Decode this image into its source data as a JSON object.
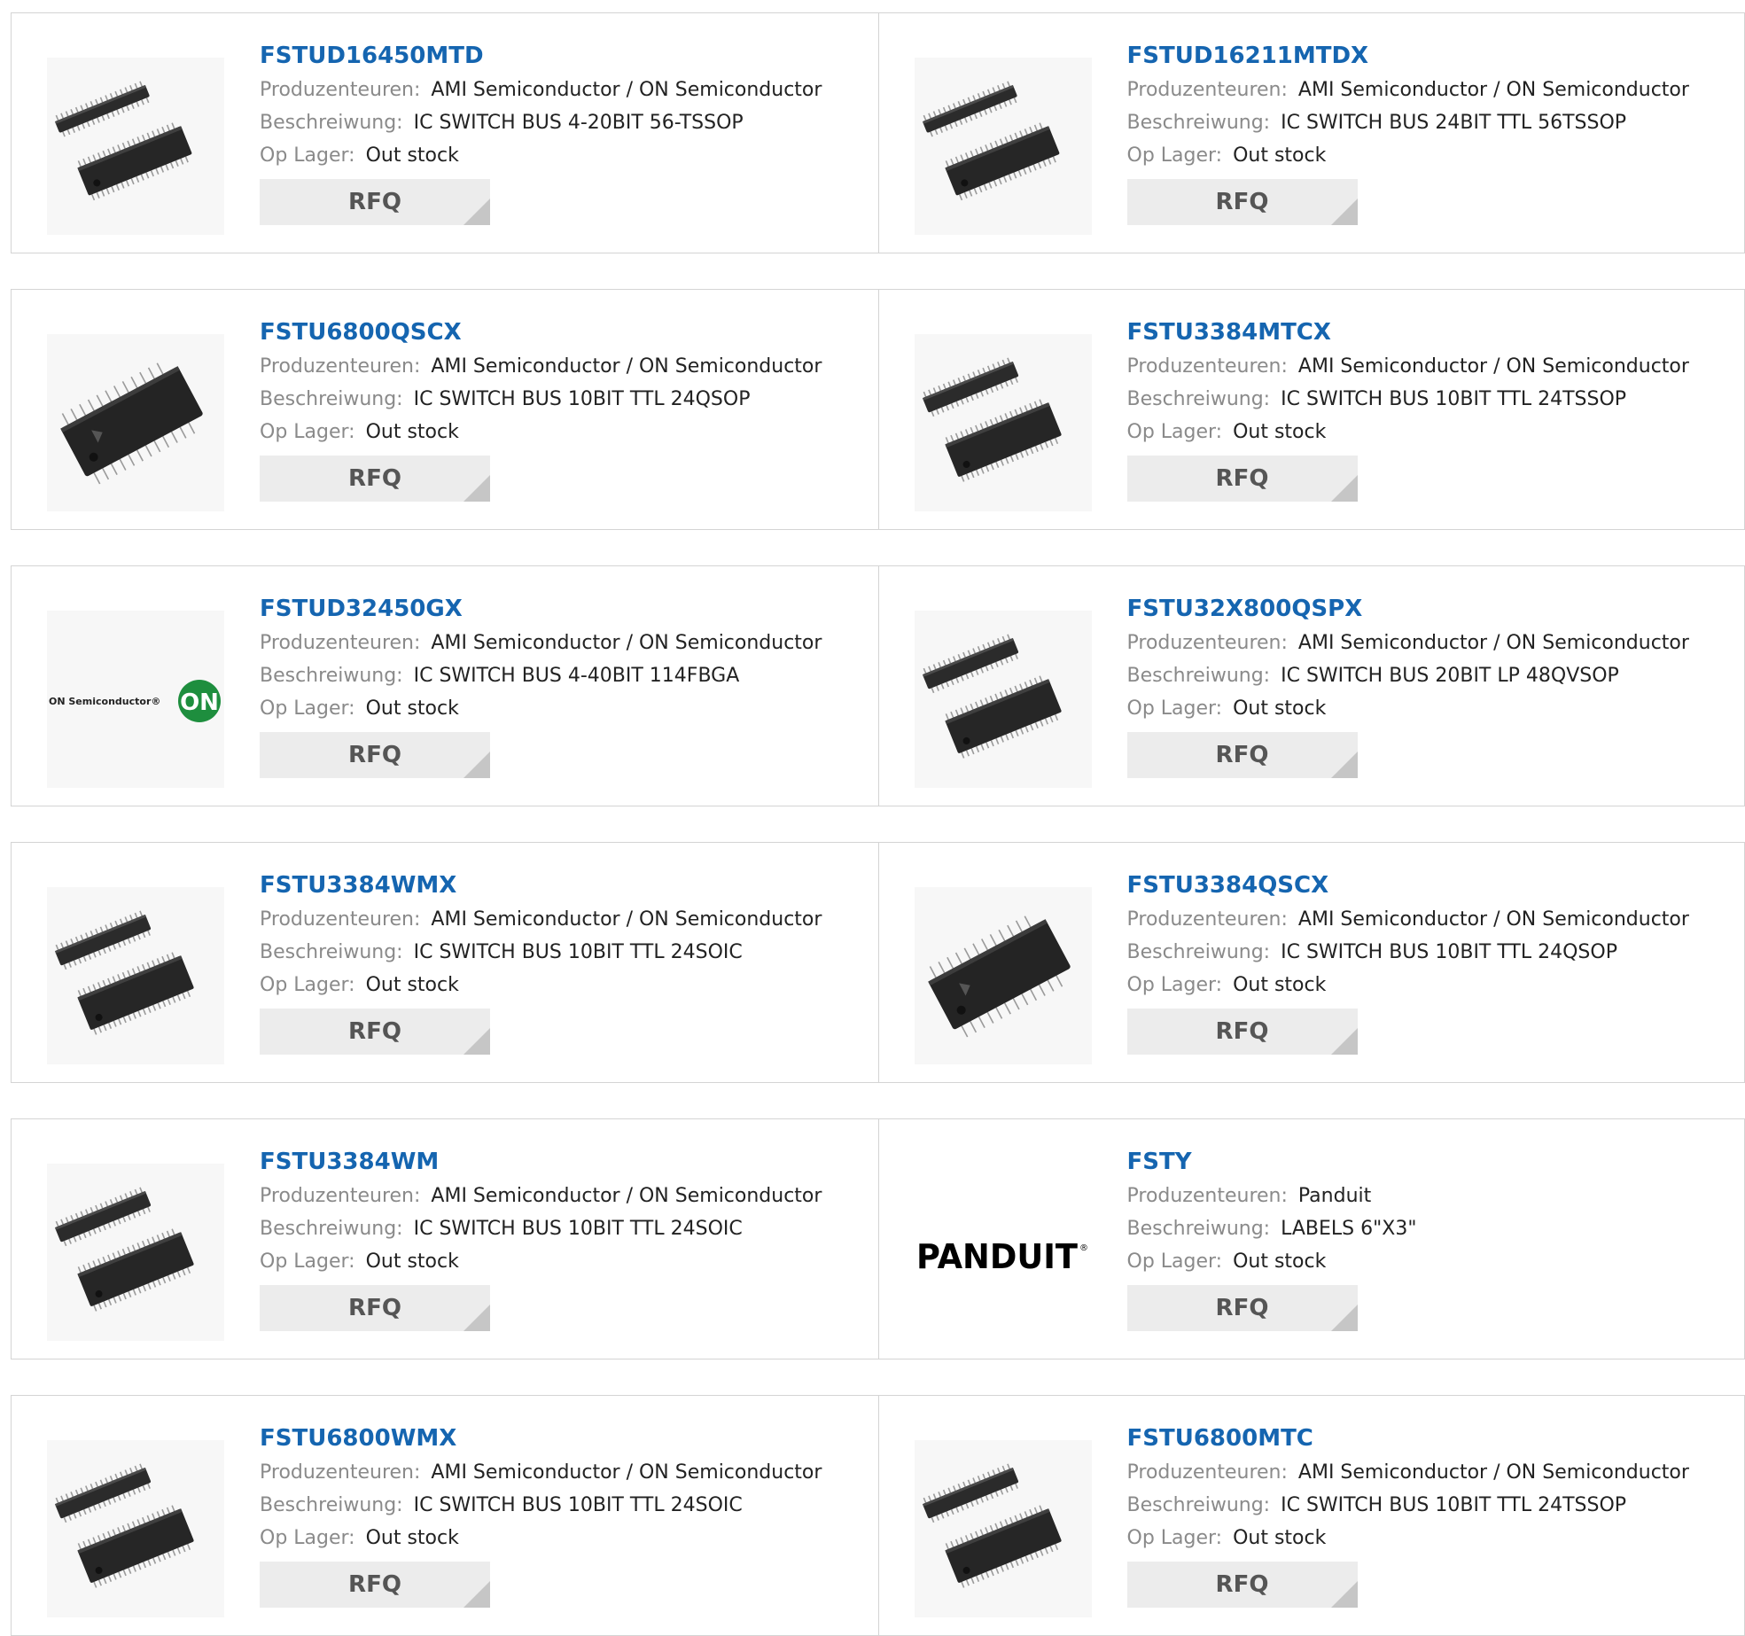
{
  "labels": {
    "manufacturer": "Produzenteuren:",
    "description": "Beschreiwung:",
    "stock": "Op Lager:"
  },
  "products": [
    {
      "part": "FSTUD16450MTD",
      "manufacturer": "AMI Semiconductor / ON Semiconductor",
      "description": "IC SWITCH BUS 4-20BIT 56-TSSOP",
      "stock": "Out stock",
      "button": "RFQ",
      "image": "tssop-chip-pair"
    },
    {
      "part": "FSTUD16211MTDX",
      "manufacturer": "AMI Semiconductor / ON Semiconductor",
      "description": "IC SWITCH BUS 24BIT TTL 56TSSOP",
      "stock": "Out stock",
      "button": "RFQ",
      "image": "tssop-chip-pair"
    },
    {
      "part": "FSTU6800QSCX",
      "manufacturer": "AMI Semiconductor / ON Semiconductor",
      "description": "IC SWITCH BUS 10BIT TTL 24QSOP",
      "stock": "Out stock",
      "button": "RFQ",
      "image": "qsop-chip"
    },
    {
      "part": "FSTU3384MTCX",
      "manufacturer": "AMI Semiconductor / ON Semiconductor",
      "description": "IC SWITCH BUS 10BIT TTL 24TSSOP",
      "stock": "Out stock",
      "button": "RFQ",
      "image": "soic-chip-pair"
    },
    {
      "part": "FSTUD32450GX",
      "manufacturer": "AMI Semiconductor / ON Semiconductor",
      "description": "IC SWITCH BUS 4-40BIT 114FBGA",
      "stock": "Out stock",
      "button": "RFQ",
      "image": "on-semiconductor-logo"
    },
    {
      "part": "FSTU32X800QSPX",
      "manufacturer": "AMI Semiconductor / ON Semiconductor",
      "description": "IC SWITCH BUS 20BIT LP 48QVSOP",
      "stock": "Out stock",
      "button": "RFQ",
      "image": "soic-chip-pair"
    },
    {
      "part": "FSTU3384WMX",
      "manufacturer": "AMI Semiconductor / ON Semiconductor",
      "description": "IC SWITCH BUS 10BIT TTL 24SOIC",
      "stock": "Out stock",
      "button": "RFQ",
      "image": "soic-chip-pair"
    },
    {
      "part": "FSTU3384QSCX",
      "manufacturer": "AMI Semiconductor / ON Semiconductor",
      "description": "IC SWITCH BUS 10BIT TTL 24QSOP",
      "stock": "Out stock",
      "button": "RFQ",
      "image": "qsop-chip"
    },
    {
      "part": "FSTU3384WM",
      "manufacturer": "AMI Semiconductor / ON Semiconductor",
      "description": "IC SWITCH BUS 10BIT TTL 24SOIC",
      "stock": "Out stock",
      "button": "RFQ",
      "image": "soic-chip-pair"
    },
    {
      "part": "FSTY",
      "manufacturer": "Panduit",
      "description": "LABELS 6\"X3\"",
      "stock": "Out stock",
      "button": "RFQ",
      "image": "panduit-logo"
    },
    {
      "part": "FSTU6800WMX",
      "manufacturer": "AMI Semiconductor / ON Semiconductor",
      "description": "IC SWITCH BUS 10BIT TTL 24SOIC",
      "stock": "Out stock",
      "button": "RFQ",
      "image": "soic-chip-pair"
    },
    {
      "part": "FSTU6800MTC",
      "manufacturer": "AMI Semiconductor / ON Semiconductor",
      "description": "IC SWITCH BUS 10BIT TTL 24TSSOP",
      "stock": "Out stock",
      "button": "RFQ",
      "image": "soic-chip-pair"
    }
  ],
  "logos": {
    "on_semiconductor": {
      "wordmark": "ON Semiconductor",
      "badge": "ON",
      "registered": "®",
      "badge_color": "#1e8e3e"
    },
    "panduit": {
      "wordmark": "PANDUIT",
      "registered": "®"
    }
  },
  "colors": {
    "part_link": "#1565b0",
    "label": "#8a8a8a",
    "value": "#222222",
    "button_bg": "#ececec",
    "border": "#d4d4d4"
  }
}
